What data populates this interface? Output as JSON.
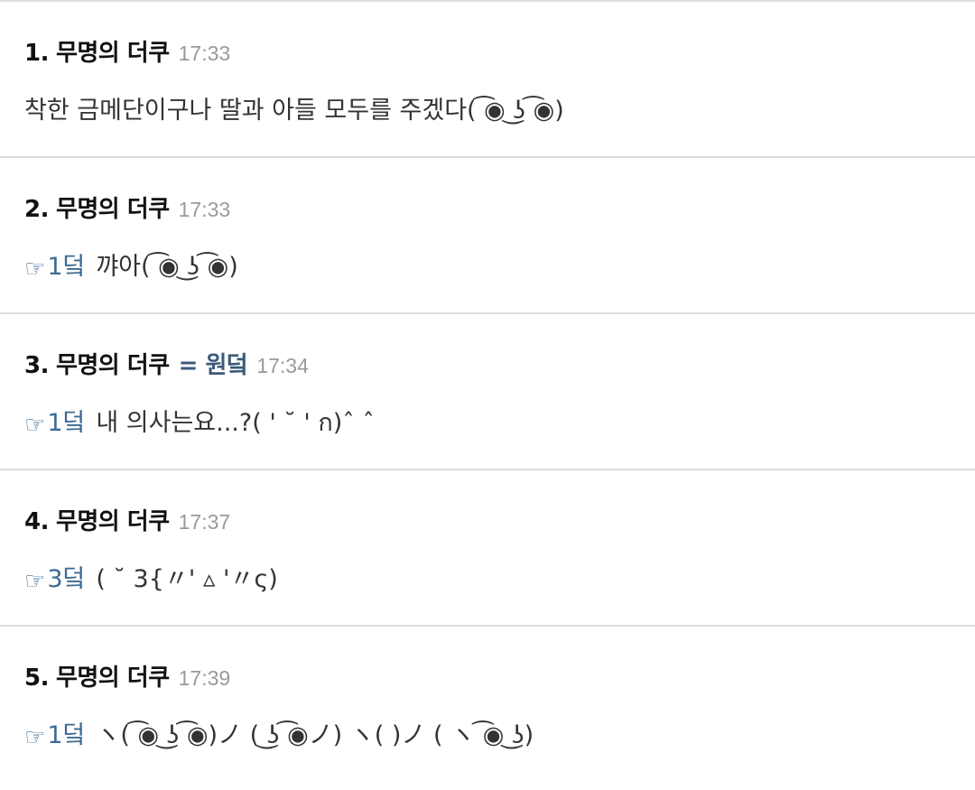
{
  "posts": [
    {
      "number": "1.",
      "author": "무명의 더쿠",
      "op_tag": "",
      "time": "17:33",
      "reply_ref": "",
      "text": "착한 금메단이구나 딸과 아들 모두를 주겠다( ͡◉ ͜ʖ ͡◉)"
    },
    {
      "number": "2.",
      "author": "무명의 더쿠",
      "op_tag": "",
      "time": "17:33",
      "reply_ref": "1덬",
      "text": "꺄아( ͡◉ ͜ʖ ͡◉)"
    },
    {
      "number": "3.",
      "author": "무명의 더쿠",
      "op_tag": "= 원덬",
      "time": "17:34",
      "reply_ref": "1덬",
      "text": "내 의사는요...?( ' ˘ ' ก)ˆ ˆ"
    },
    {
      "number": "4.",
      "author": "무명의 더쿠",
      "op_tag": "",
      "time": "17:37",
      "reply_ref": "3덬",
      "text": "( ˘ 3{〃' ▵ '〃ς)"
    },
    {
      "number": "5.",
      "author": "무명의 더쿠",
      "op_tag": "",
      "time": "17:39",
      "reply_ref": "1덬",
      "text": "ヽ( ͡◉ ͜ʖ ͡◉)ノ  ( ͜ʖ ͡◉ノ)  ヽ(    )ノ  ( ヽ ͡◉ ͜ʖ)"
    }
  ],
  "icons": {
    "reply": "anchor-arrow-icon"
  },
  "colors": {
    "op_tag": "#3d5a7a",
    "reply_link": "#3d6a94",
    "time": "#9a9a9a",
    "divider": "#dddddd"
  }
}
